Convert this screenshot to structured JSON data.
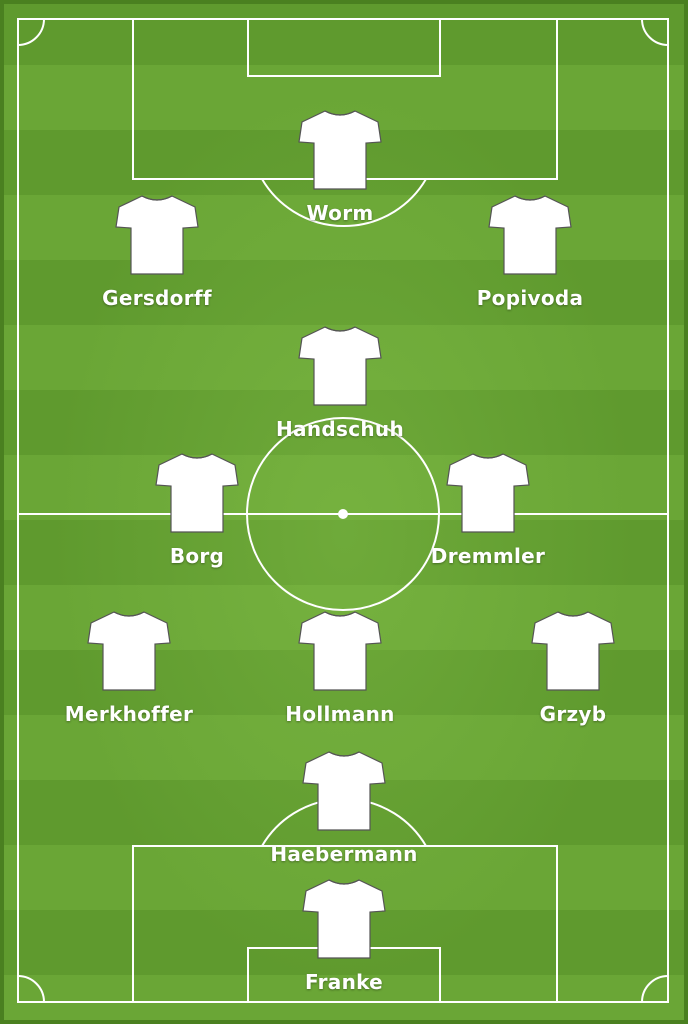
{
  "lineup": {
    "players": [
      {
        "name": "Worm",
        "role": "forward-center"
      },
      {
        "name": "Gersdorff",
        "role": "forward-left"
      },
      {
        "name": "Popivoda",
        "role": "forward-right"
      },
      {
        "name": "Handschuh",
        "role": "attacking-mid"
      },
      {
        "name": "Borg",
        "role": "mid-left"
      },
      {
        "name": "Dremmler",
        "role": "mid-right"
      },
      {
        "name": "Merkhoffer",
        "role": "defender-left"
      },
      {
        "name": "Hollmann",
        "role": "defender-center"
      },
      {
        "name": "Grzyb",
        "role": "defender-right"
      },
      {
        "name": "Haebermann",
        "role": "sweeper"
      },
      {
        "name": "Franke",
        "role": "goalkeeper"
      }
    ]
  },
  "colors": {
    "grass_dark": "#5f9a2e",
    "grass_light": "#6aa636",
    "line": "#ffffff",
    "shirt": "#ffffff"
  },
  "icons": {
    "shirt": "shirt-icon"
  }
}
